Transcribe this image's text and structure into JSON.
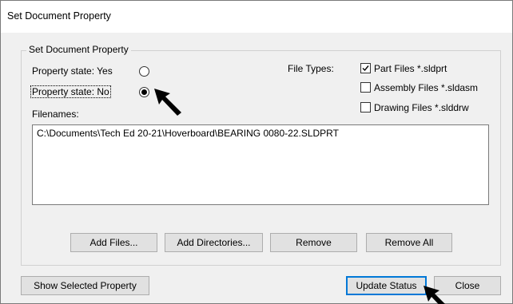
{
  "window": {
    "title": "Set Document Property"
  },
  "group": {
    "legend": "Set Document Property"
  },
  "property_state": {
    "yes_label": "Property state: Yes",
    "no_label": "Property state: No",
    "selected": "No"
  },
  "file_types": {
    "label": "File Types:",
    "options": [
      {
        "label": "Part Files *.sldprt",
        "checked": true
      },
      {
        "label": "Assembly Files *.sldasm",
        "checked": false
      },
      {
        "label": "Drawing Files *.slddrw",
        "checked": false
      }
    ]
  },
  "filenames": {
    "label": "Filenames:",
    "items": [
      "C:\\Documents\\Tech Ed 20-21\\Hoverboard\\BEARING 0080-22.SLDPRT"
    ]
  },
  "buttons": {
    "add_files": "Add Files...",
    "add_directories": "Add Directories...",
    "remove": "Remove",
    "remove_all": "Remove All",
    "show_selected_property": "Show Selected Property",
    "update_status": "Update Status",
    "close": "Close"
  }
}
